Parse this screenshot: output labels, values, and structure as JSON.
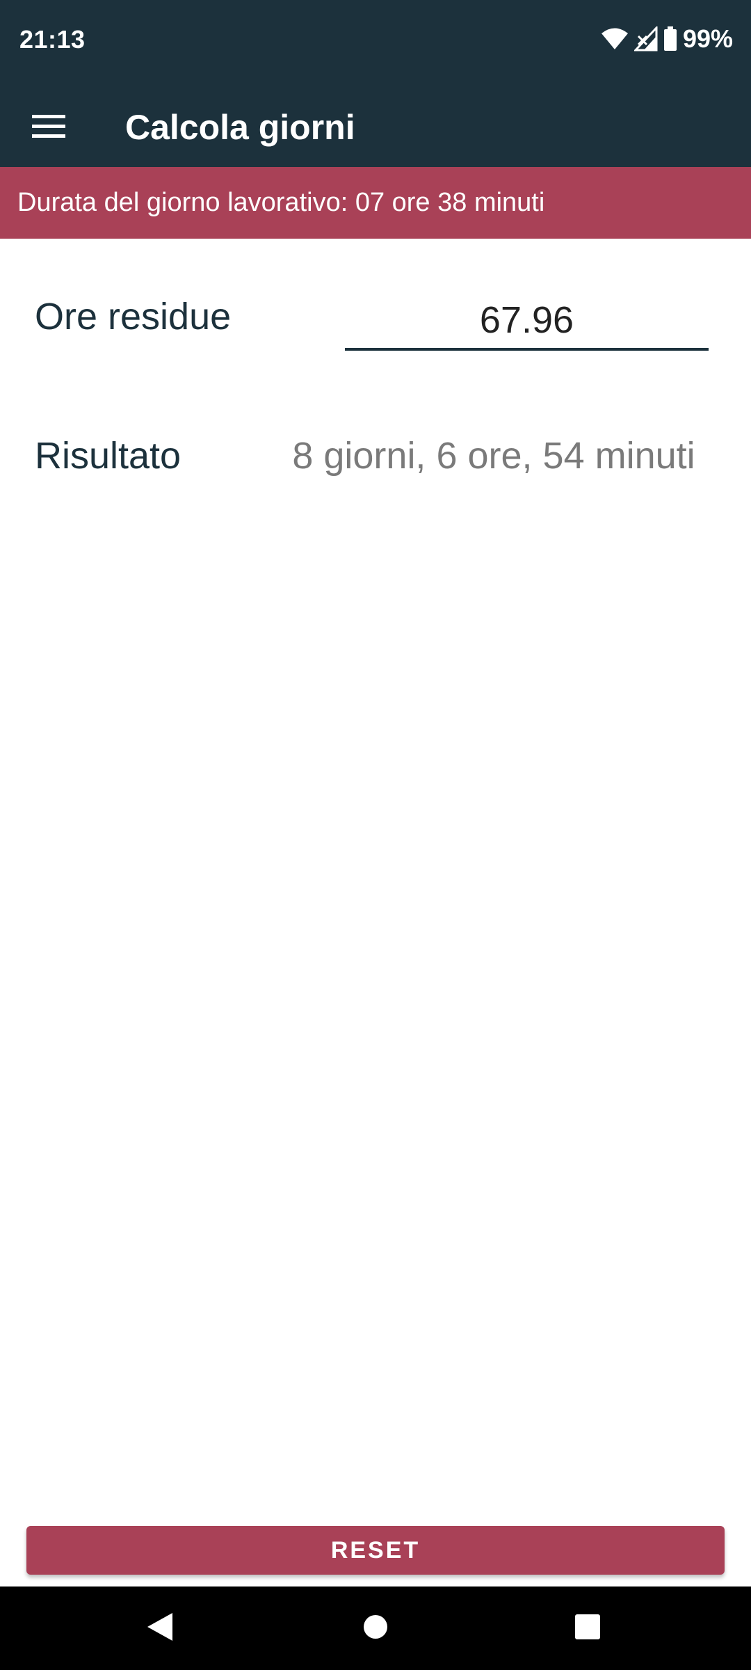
{
  "status_bar": {
    "time": "21:13",
    "battery": "99%",
    "icons": [
      "wifi-icon",
      "signal-icon",
      "battery-icon"
    ]
  },
  "app_bar": {
    "menu_icon": "menu-icon",
    "title": "Calcola giorni"
  },
  "banner": {
    "text": "Durata del giorno lavorativo: 07 ore 38 minuti"
  },
  "form": {
    "ore_residue_label": "Ore residue",
    "ore_residue_value": "67.96",
    "risultato_label": "Risultato",
    "risultato_value": "8 giorni, 6 ore, 54 minuti"
  },
  "reset_button": {
    "label": "RESET"
  },
  "nav_bar": {
    "icons": [
      "back-icon",
      "home-icon",
      "recents-icon"
    ]
  },
  "colors": {
    "primary_dark": "#1c313c",
    "accent": "#a94157",
    "result_text": "#7a7a7a"
  }
}
